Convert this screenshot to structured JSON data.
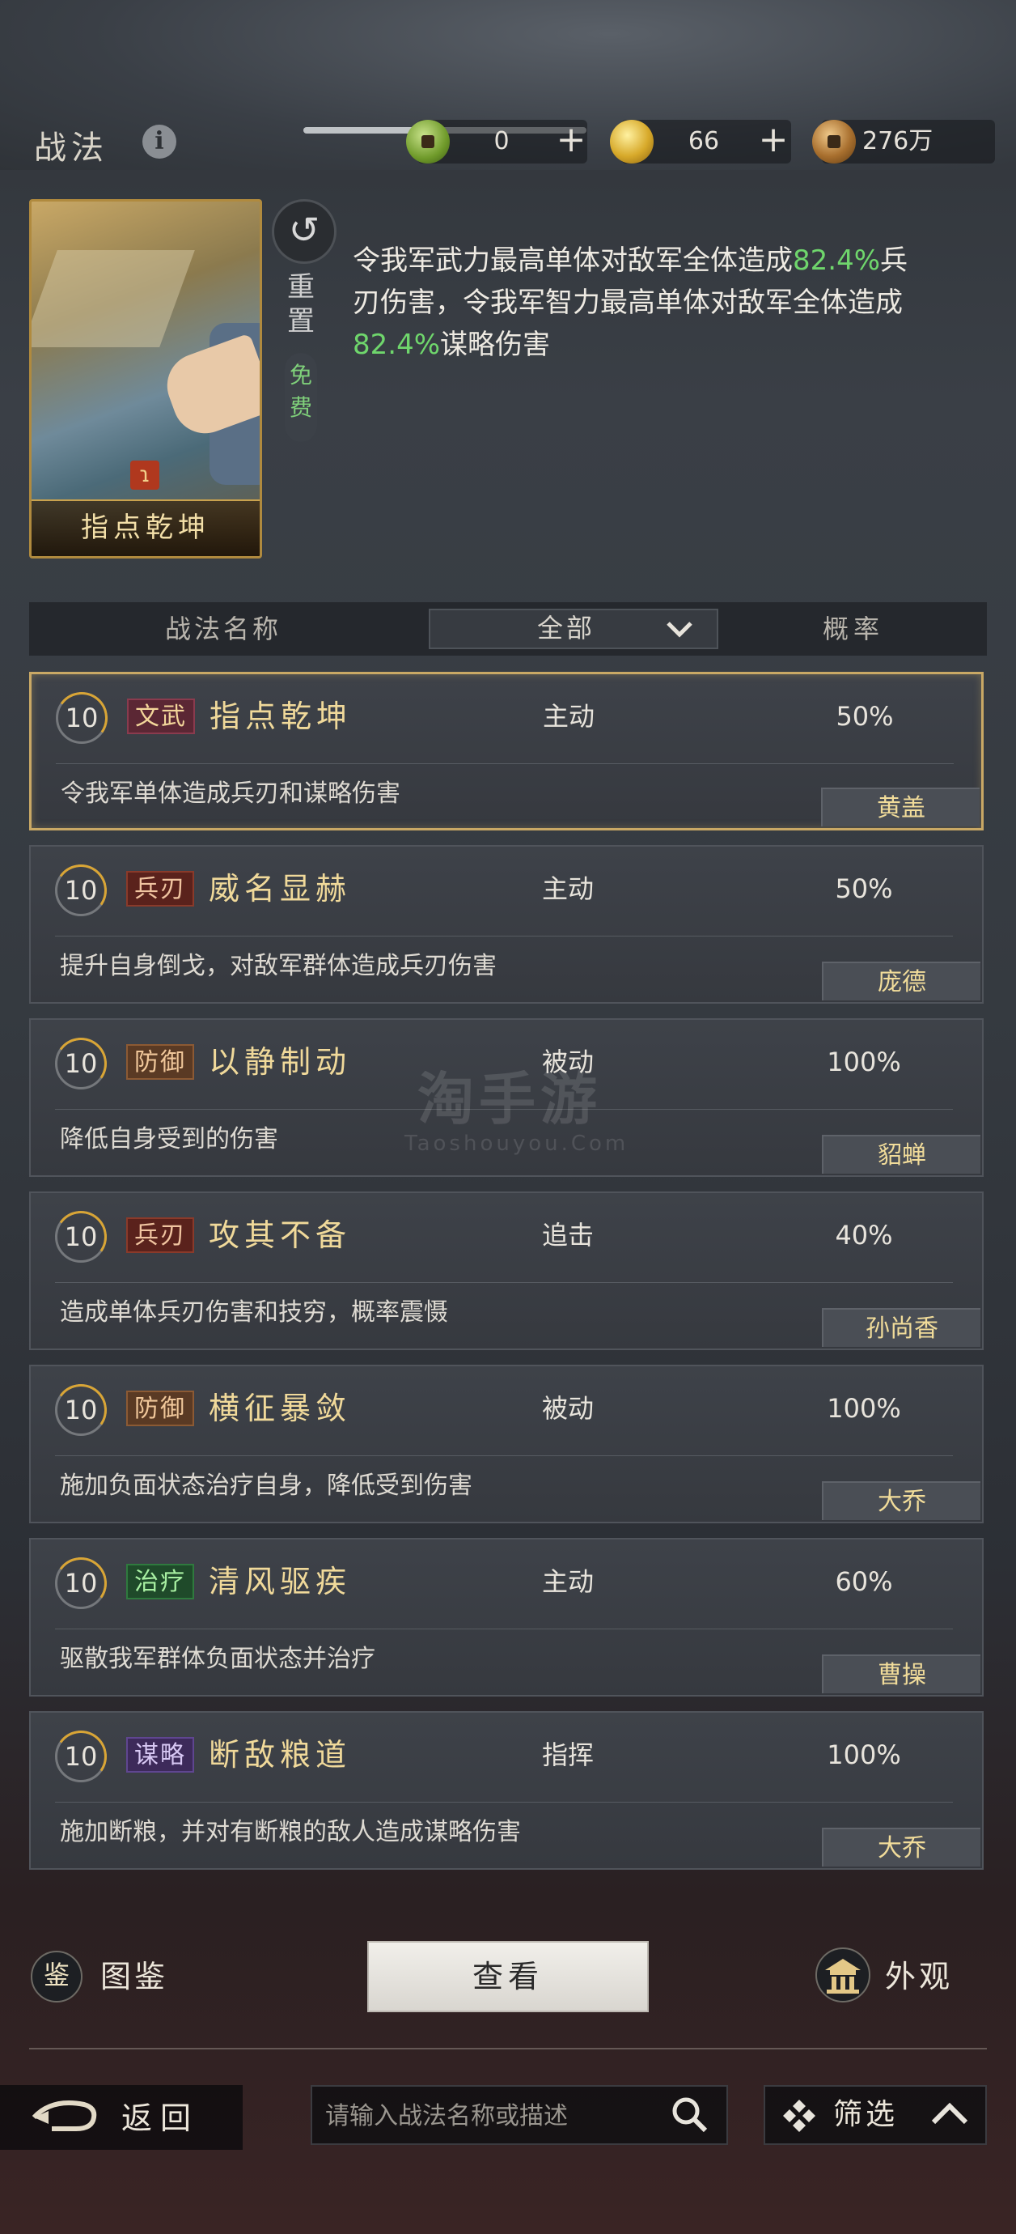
{
  "header": {
    "title": "战法",
    "info_icon": "info-icon",
    "currency": [
      {
        "icon": "jade-coin-icon",
        "value": "0",
        "has_plus": true
      },
      {
        "icon": "gold-coin-icon",
        "value": "66",
        "has_plus": true
      },
      {
        "icon": "copper-coin-icon",
        "value": "276万",
        "has_plus": false
      }
    ],
    "plus_label": "+"
  },
  "selected": {
    "card_name": "指点乾坤",
    "reset_label": "重置",
    "free_label": "免费",
    "desc_parts": [
      "令我军武力最高单体对敌军全体造成",
      "82.4%",
      "兵刃伤害，令我军智力最高单体对敌军全体造成",
      "82.4%",
      "谋略伤害"
    ]
  },
  "table_header": {
    "name": "战法名称",
    "filter": "全部",
    "rate": "概率"
  },
  "rows": [
    {
      "level": "10",
      "tag": "文武",
      "tag_class": "tag-wenwu",
      "name": "指点乾坤",
      "type": "主动",
      "rate": "50%",
      "desc": "令我军单体造成兵刃和谋略伤害",
      "hero": "黄盖",
      "selected": true
    },
    {
      "level": "10",
      "tag": "兵刃",
      "tag_class": "tag-bingren",
      "name": "威名显赫",
      "type": "主动",
      "rate": "50%",
      "desc": "提升自身倒戈，对敌军群体造成兵刃伤害",
      "hero": "庞德",
      "selected": false
    },
    {
      "level": "10",
      "tag": "防御",
      "tag_class": "tag-fangyu",
      "name": "以静制动",
      "type": "被动",
      "rate": "100%",
      "desc": "降低自身受到的伤害",
      "hero": "貂蝉",
      "selected": false
    },
    {
      "level": "10",
      "tag": "兵刃",
      "tag_class": "tag-bingren",
      "name": "攻其不备",
      "type": "追击",
      "rate": "40%",
      "desc": "造成单体兵刃伤害和技穷，概率震慑",
      "hero": "孙尚香",
      "selected": false
    },
    {
      "level": "10",
      "tag": "防御",
      "tag_class": "tag-fangyu",
      "name": "横征暴敛",
      "type": "被动",
      "rate": "100%",
      "desc": "施加负面状态治疗自身，降低受到伤害",
      "hero": "大乔",
      "selected": false
    },
    {
      "level": "10",
      "tag": "治疗",
      "tag_class": "tag-zhiliao",
      "name": "清风驱疾",
      "type": "主动",
      "rate": "60%",
      "desc": "驱散我军群体负面状态并治疗",
      "hero": "曹操",
      "selected": false
    },
    {
      "level": "10",
      "tag": "谋略",
      "tag_class": "tag-moulue",
      "name": "断敌粮道",
      "type": "指挥",
      "rate": "100%",
      "desc": "施加断粮，并对有断粮的敌人造成谋略伤害",
      "hero": "大乔",
      "selected": false
    }
  ],
  "bottom": {
    "codex_icon_glyph": "鉴",
    "codex_label": "图鉴",
    "view_label": "查看",
    "appearance_label": "外观",
    "back_label": "返回",
    "search_placeholder": "请输入战法名称或描述",
    "filter_label": "筛选"
  },
  "watermark": {
    "line1": "淘手游",
    "line2": "Taoshouyou.Com"
  },
  "colors": {
    "accent_gold": "#c9a865",
    "desc_highlight": "#6fd66c"
  }
}
